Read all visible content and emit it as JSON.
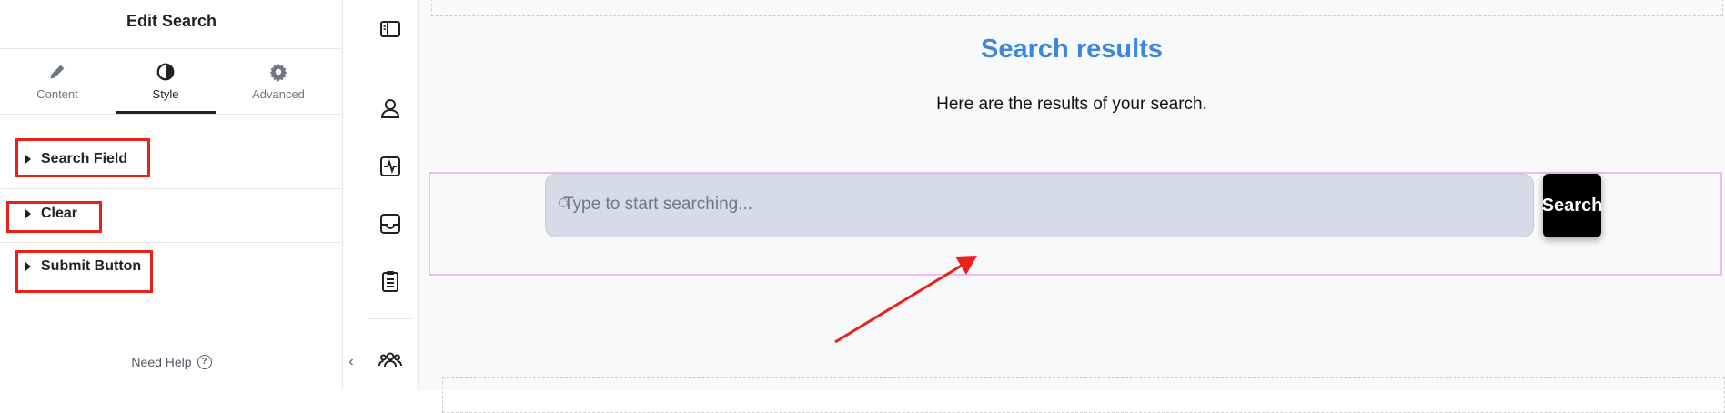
{
  "panel": {
    "title": "Edit Search",
    "tabs": [
      {
        "label": "Content",
        "icon": "pencil-icon"
      },
      {
        "label": "Style",
        "icon": "half-circle-icon"
      },
      {
        "label": "Advanced",
        "icon": "gear-icon"
      }
    ],
    "sections": [
      {
        "label": "Search Field"
      },
      {
        "label": "Clear"
      },
      {
        "label": "Submit Button"
      }
    ],
    "help_label": "Need Help",
    "help_icon": "question-icon"
  },
  "iconbar": {
    "icons": [
      "sidebar-toggle-icon",
      "user-icon",
      "activity-icon",
      "inbox-icon",
      "clipboard-icon",
      "users-icon"
    ]
  },
  "canvas": {
    "heading": "Search results",
    "subtext": "Here are the results of your search.",
    "search": {
      "placeholder": "Type to start searching...",
      "button_label": "Search"
    }
  },
  "colors": {
    "heading": "#3c86de",
    "annotation_red": "#e8211b",
    "widget_outline": "#f3b8f3",
    "input_bg": "#d6dce7",
    "button_bg": "#000000"
  }
}
